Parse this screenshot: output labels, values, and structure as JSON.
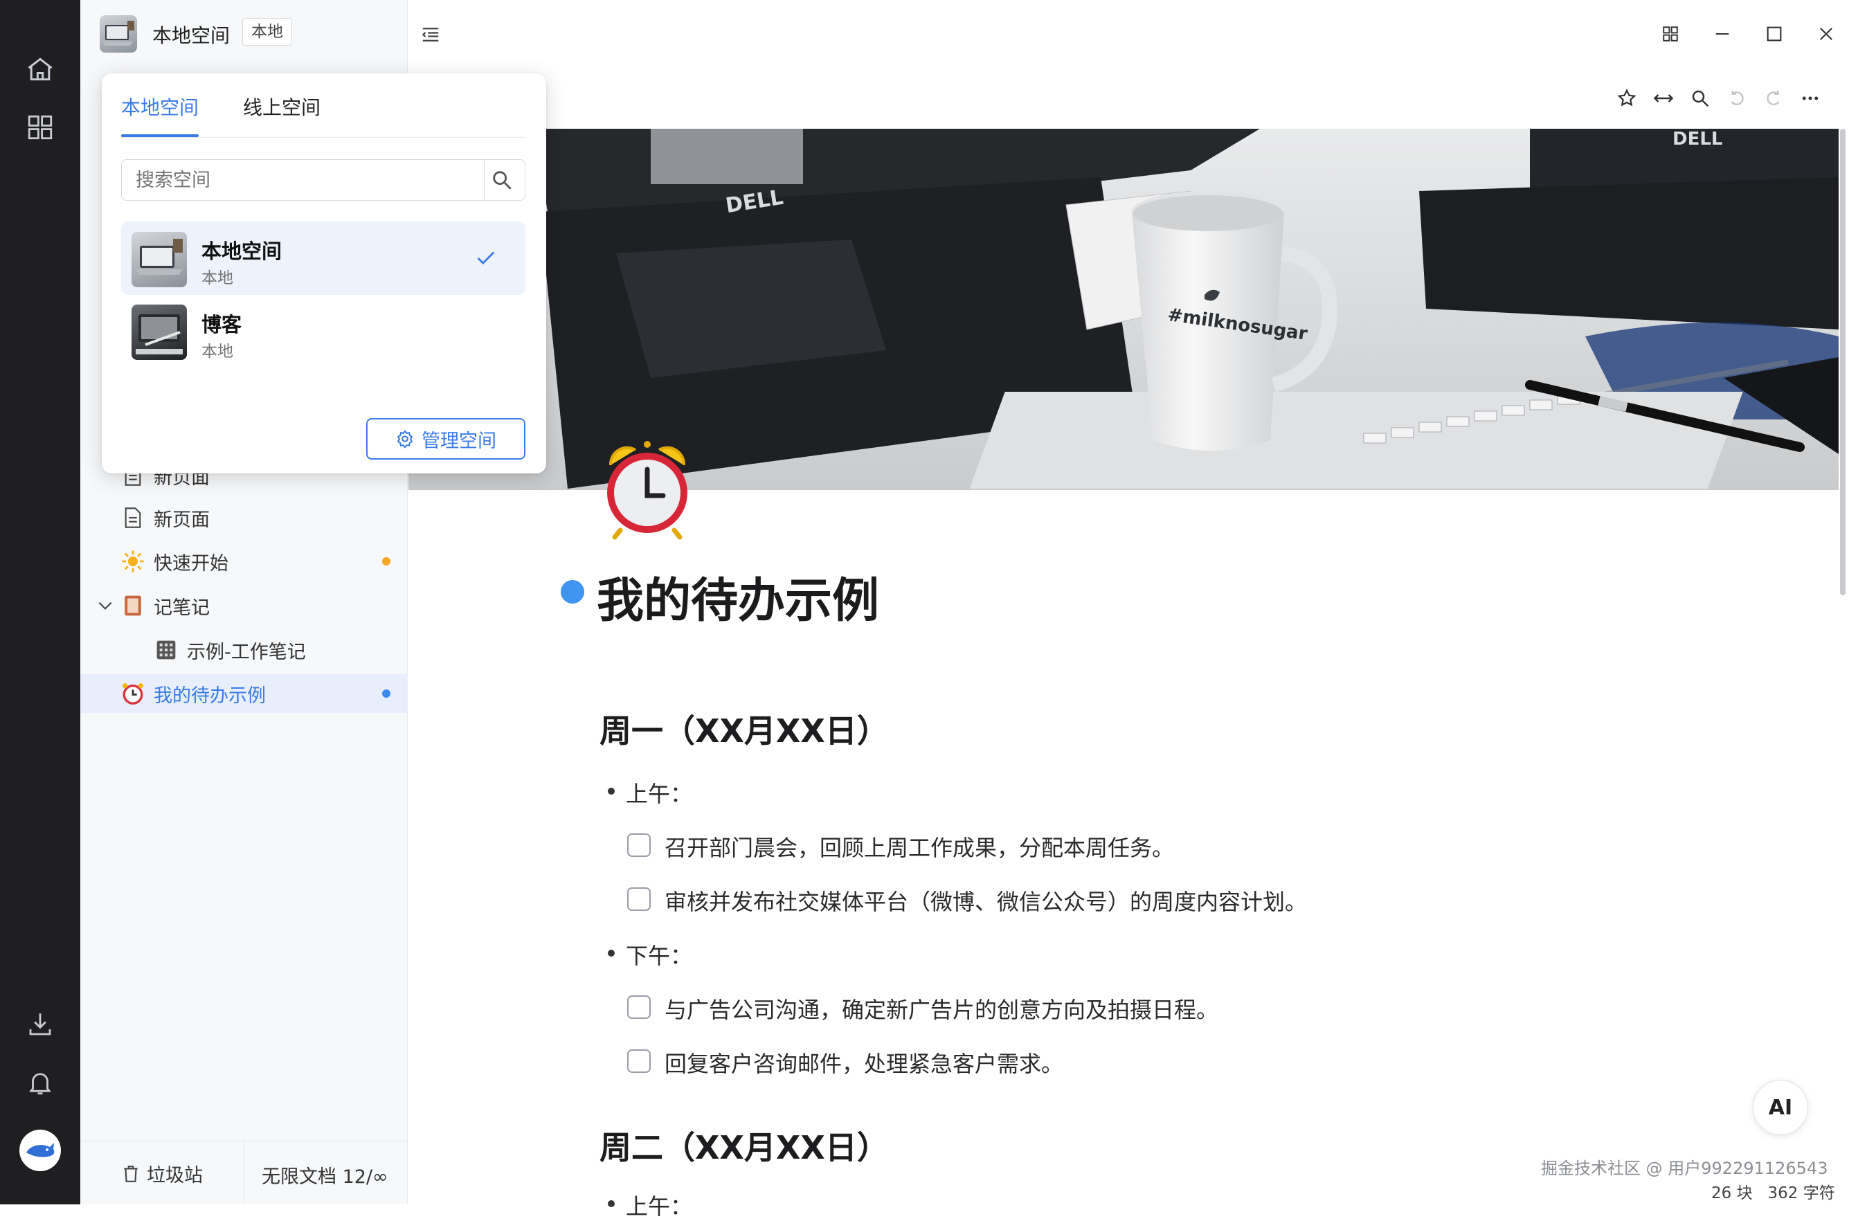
{
  "rail": {
    "icons": [
      "home-icon",
      "apps-grid-icon",
      "download-icon",
      "bell-icon",
      "avatar"
    ]
  },
  "sidebar": {
    "workspace_name": "本地空间",
    "workspace_tag": "本地",
    "tree": [
      {
        "label": "新页面",
        "icon": "page-icon"
      },
      {
        "label": "新页面",
        "icon": "page-icon"
      },
      {
        "label": "快速开始",
        "icon": "sun-icon",
        "dot": "#f5a623"
      },
      {
        "label": "记笔记",
        "icon": "notebook-icon"
      },
      {
        "label": "示例-工作笔记",
        "icon": "grid-paper-icon"
      },
      {
        "label": "我的待办示例",
        "icon": "alarm-clock-icon",
        "dot": "#3b8bea",
        "active": true
      }
    ],
    "footer": {
      "trash": "垃圾站",
      "quota": "无限文档 12/∞"
    }
  },
  "popup": {
    "tabs": [
      "本地空间",
      "线上空间"
    ],
    "search_placeholder": "搜索空间",
    "workspaces": [
      {
        "name": "本地空间",
        "type": "本地",
        "selected": true
      },
      {
        "name": "博客",
        "type": "本地",
        "selected": false
      }
    ],
    "manage_button": "管理空间"
  },
  "document": {
    "cover_mug_text": "#milknosugar",
    "cover_brand_1": "DELL",
    "cover_brand_2": "DELL",
    "title": "我的待办示例",
    "sections": [
      {
        "heading": "周一（XX月XX日）",
        "groups": [
          {
            "label": "上午：",
            "tasks": [
              "召开部门晨会，回顾上周工作成果，分配本周任务。",
              "审核并发布社交媒体平台（微博、微信公众号）的周度内容计划。"
            ]
          },
          {
            "label": "下午：",
            "tasks": [
              "与广告公司沟通，确定新广告片的创意方向及拍摄日程。",
              "回复客户咨询邮件，处理紧急客户需求。"
            ]
          }
        ]
      },
      {
        "heading": "周二（XX月XX日）",
        "groups": [
          {
            "label": "上午：",
            "tasks": []
          }
        ]
      }
    ]
  },
  "status": {
    "watermark": "掘金技术社区 @ 用户992291126543",
    "counts": "26 块   362 字符"
  },
  "ai_button": "AI",
  "colors": {
    "accent": "#3b7be9",
    "rail_bg": "#1f1f22",
    "active_row": "#e8eefb"
  }
}
